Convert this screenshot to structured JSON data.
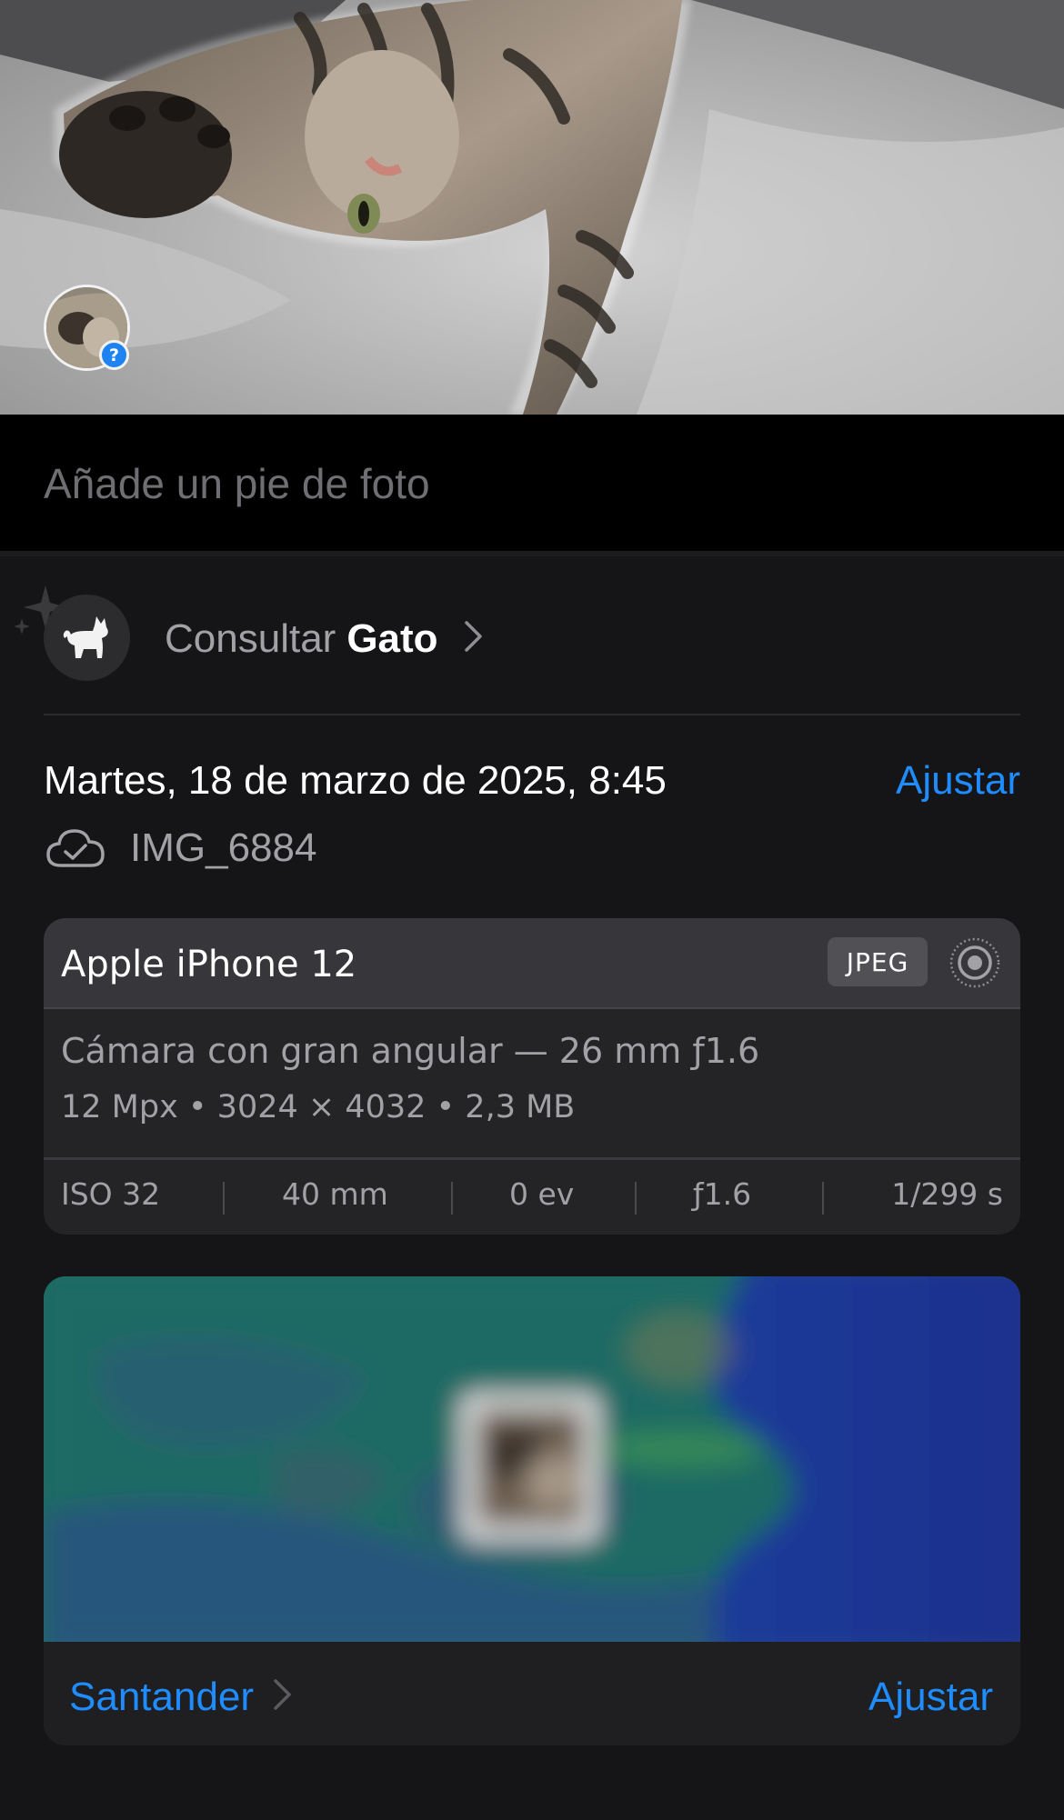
{
  "photo": {
    "subject": "cat",
    "people_badge": "?"
  },
  "caption": {
    "placeholder": "Añade un pie de foto"
  },
  "lookup": {
    "prefix": "Consultar",
    "subject": "Gato"
  },
  "details": {
    "datetime": "Martes, 18 de marzo de 2025, 8:45",
    "adjust_label": "Ajustar",
    "filename": "IMG_6884",
    "cloud_status_icon": "cloud-check-icon"
  },
  "camera": {
    "device": "Apple iPhone 12",
    "format": "JPEG",
    "lens": "Cámara con gran angular — 26 mm ƒ1.6",
    "specs": "12 Mpx  •  3024 × 4032  •  2,3 MB",
    "exif": {
      "iso": "ISO 32",
      "focal": "40 mm",
      "exposure": "0 ev",
      "aperture": "ƒ1.6",
      "shutter": "1/299 s"
    }
  },
  "map": {
    "place": "Santander",
    "adjust_label": "Ajustar"
  },
  "colors": {
    "background": "#151517",
    "accent": "#1f8cff",
    "secondary_text": "#a1a1a6"
  }
}
